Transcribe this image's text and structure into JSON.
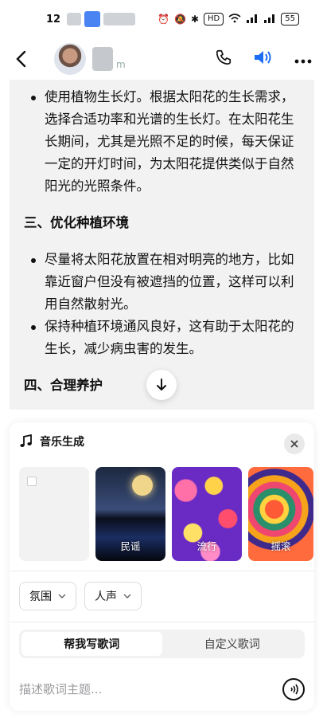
{
  "status_bar": {
    "time": "12",
    "battery": "55",
    "hd_label": "HD"
  },
  "header": {
    "contact_suffix": "m"
  },
  "content": {
    "bullets_top": [
      "使用植物生长灯。根据太阳花的生长需求，选择合适功率和光谱的生长灯。在太阳花生长期间，尤其是光照不足的时候，每天保证一定的开灯时间，为太阳花提供类似于自然阳光的光照条件。"
    ],
    "section3_title": "三、优化种植环境",
    "section3_bullets": [
      "尽量将太阳花放置在相对明亮的地方，比如靠近窗户但没有被遮挡的位置，这样可以利用自然散射光。",
      "保持种植环境通风良好，这有助于太阳花的生长，减少病虫害的发生。"
    ],
    "section4_title": "四、合理养护"
  },
  "music_panel": {
    "title": "音乐生成",
    "styles": [
      {
        "label": ""
      },
      {
        "label": "民谣"
      },
      {
        "label": "流行"
      },
      {
        "label": "摇滚"
      }
    ],
    "selects": {
      "mood": "氛围",
      "vocal": "人声"
    },
    "tabs": {
      "write_for_me": "帮我写歌词",
      "custom": "自定义歌词"
    },
    "input_placeholder": "描述歌词主题..."
  }
}
